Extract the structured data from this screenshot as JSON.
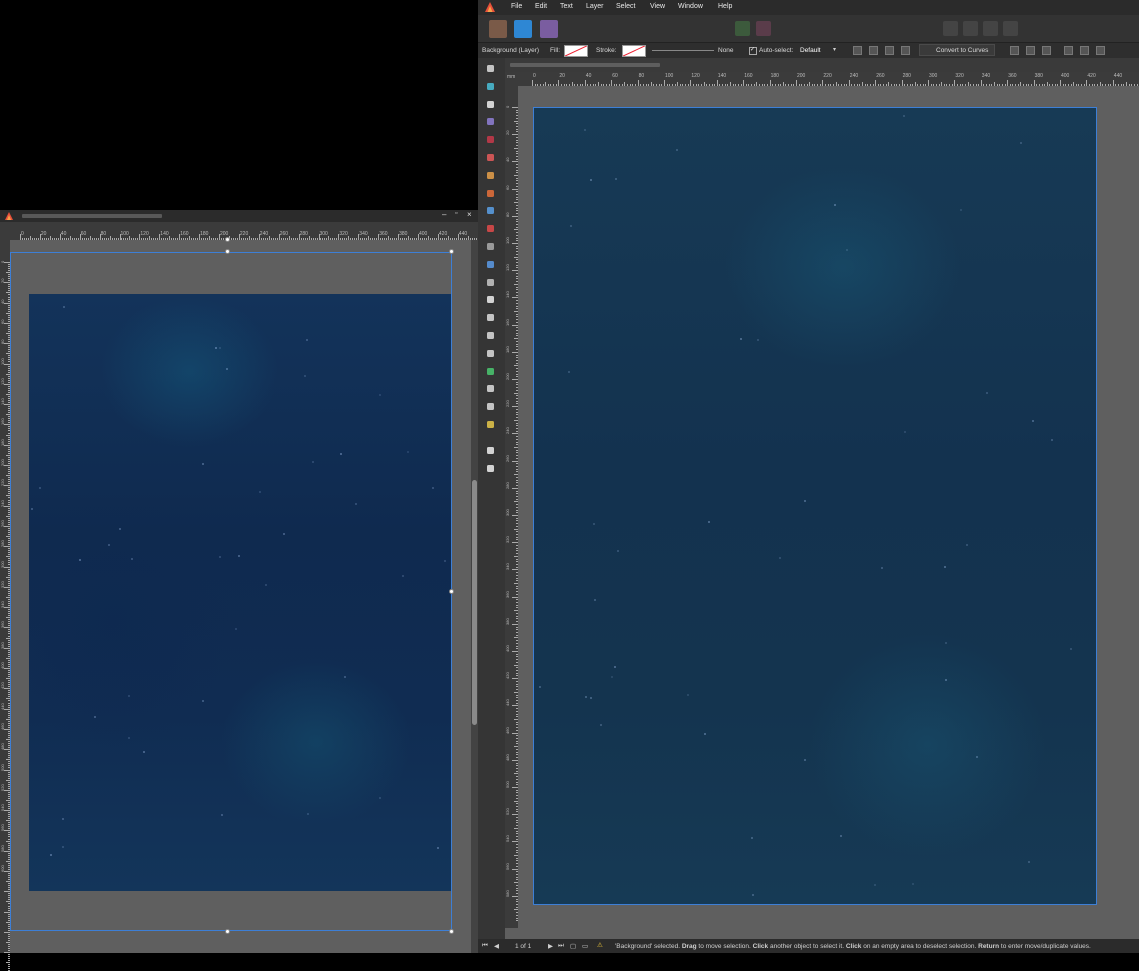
{
  "menu": {
    "items": [
      "File",
      "Edit",
      "Text",
      "Layer",
      "Select",
      "View",
      "Window",
      "Help"
    ]
  },
  "context": {
    "object_label": "Background (Layer)",
    "fill_label": "Fill:",
    "stroke_label": "Stroke:",
    "stroke_none": "None",
    "auto_select_label": "Auto-select:",
    "auto_select_value": "Default",
    "convert_label": "Convert to Curves"
  },
  "ruler": {
    "unit": "mm",
    "top_labels": [
      "0",
      "20",
      "40",
      "60",
      "80",
      "100",
      "120",
      "140",
      "160",
      "180",
      "200",
      "220",
      "240",
      "260",
      "280",
      "300",
      "320",
      "340",
      "360",
      "380",
      "400",
      "420",
      "440"
    ],
    "left_labels": [
      "0",
      "20",
      "40",
      "60",
      "80",
      "100",
      "120",
      "140",
      "160",
      "180",
      "200",
      "220",
      "240",
      "260",
      "280",
      "300",
      "320",
      "340",
      "360",
      "380",
      "400",
      "420",
      "440",
      "460",
      "480",
      "500",
      "520",
      "540",
      "560",
      "580",
      "600"
    ]
  },
  "status": {
    "page_text": "1 of 1",
    "message_parts": [
      {
        "t": "'Background' selected. ",
        "b": false
      },
      {
        "t": "Drag",
        "b": true
      },
      {
        "t": " to move selection. ",
        "b": false
      },
      {
        "t": "Click",
        "b": true
      },
      {
        "t": " another object to select it. ",
        "b": false
      },
      {
        "t": "Click",
        "b": true
      },
      {
        "t": " on an empty area to deselect selection. ",
        "b": false
      },
      {
        "t": "Return",
        "b": true
      },
      {
        "t": " to enter move/duplicate values.",
        "b": false
      }
    ]
  },
  "colors": {
    "selection": "#3d7fd6",
    "accent_red": "#e23b2e"
  },
  "icons": {
    "app": "affinity-designer-logo",
    "tools": [
      "move-tool",
      "artboard-tool",
      "node-tool",
      "point-transform-tool",
      "fill-tool",
      "pen-tool",
      "pencil-tool",
      "vector-brush-tool",
      "pixel-brush-tool",
      "color-picker-tool",
      "transparency-tool",
      "place-image-tool",
      "mesh-tool",
      "crop-tool",
      "rectangle-tool",
      "ellipse-tool",
      "shape-tool",
      "fill-circle-tool",
      "frame-text-tool",
      "knife-tool",
      "measure-tool",
      "zoom-tool",
      "color-swatch-tool"
    ]
  }
}
